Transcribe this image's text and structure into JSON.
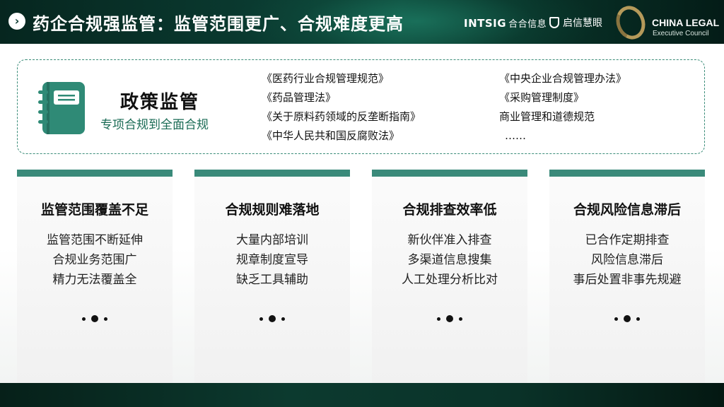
{
  "header": {
    "title": "药企合规强监管：监管范围更广、合规难度更高",
    "logos": {
      "intsig": "INTSIG",
      "intsig_cn": "合合信息",
      "qixin": "启信慧眼",
      "cle_line1": "CHINA LEGAL",
      "cle_line2": "Executive Council"
    }
  },
  "policy": {
    "title": "政策监管",
    "subtitle": "专项合规到全面合规",
    "left_docs": [
      "《医药行业合规管理规范》",
      "《药品管理法》",
      "《关于原料药领域的反垄断指南》",
      "《中华人民共和国反腐败法》"
    ],
    "right_docs": [
      "《中央企业合规管理办法》",
      "《采购管理制度》",
      "商业管理和道德规范",
      "……"
    ]
  },
  "cards": [
    {
      "title": "监管范围覆盖不足",
      "items": [
        "监管范围不断延伸",
        "合规业务范围广",
        "精力无法覆盖全"
      ]
    },
    {
      "title": "合规规则难落地",
      "items": [
        "大量内部培训",
        "规章制度宣导",
        "缺乏工具辅助"
      ]
    },
    {
      "title": "合规排查效率低",
      "items": [
        "新伙伴准入排查",
        "多渠道信息搜集",
        "人工处理分析比对"
      ]
    },
    {
      "title": "合规风险信息滞后",
      "items": [
        "已合作定期排查",
        "风险信息滞后",
        "事后处置非事先规避"
      ]
    }
  ],
  "colors": {
    "accent": "#3a8a7a",
    "header_dark": "#0a3a30",
    "subtitle_green": "#1a6b55"
  },
  "icons": {
    "header": "chevron-right-icon",
    "policy": "notebook-icon",
    "qixin": "shield-icon"
  }
}
